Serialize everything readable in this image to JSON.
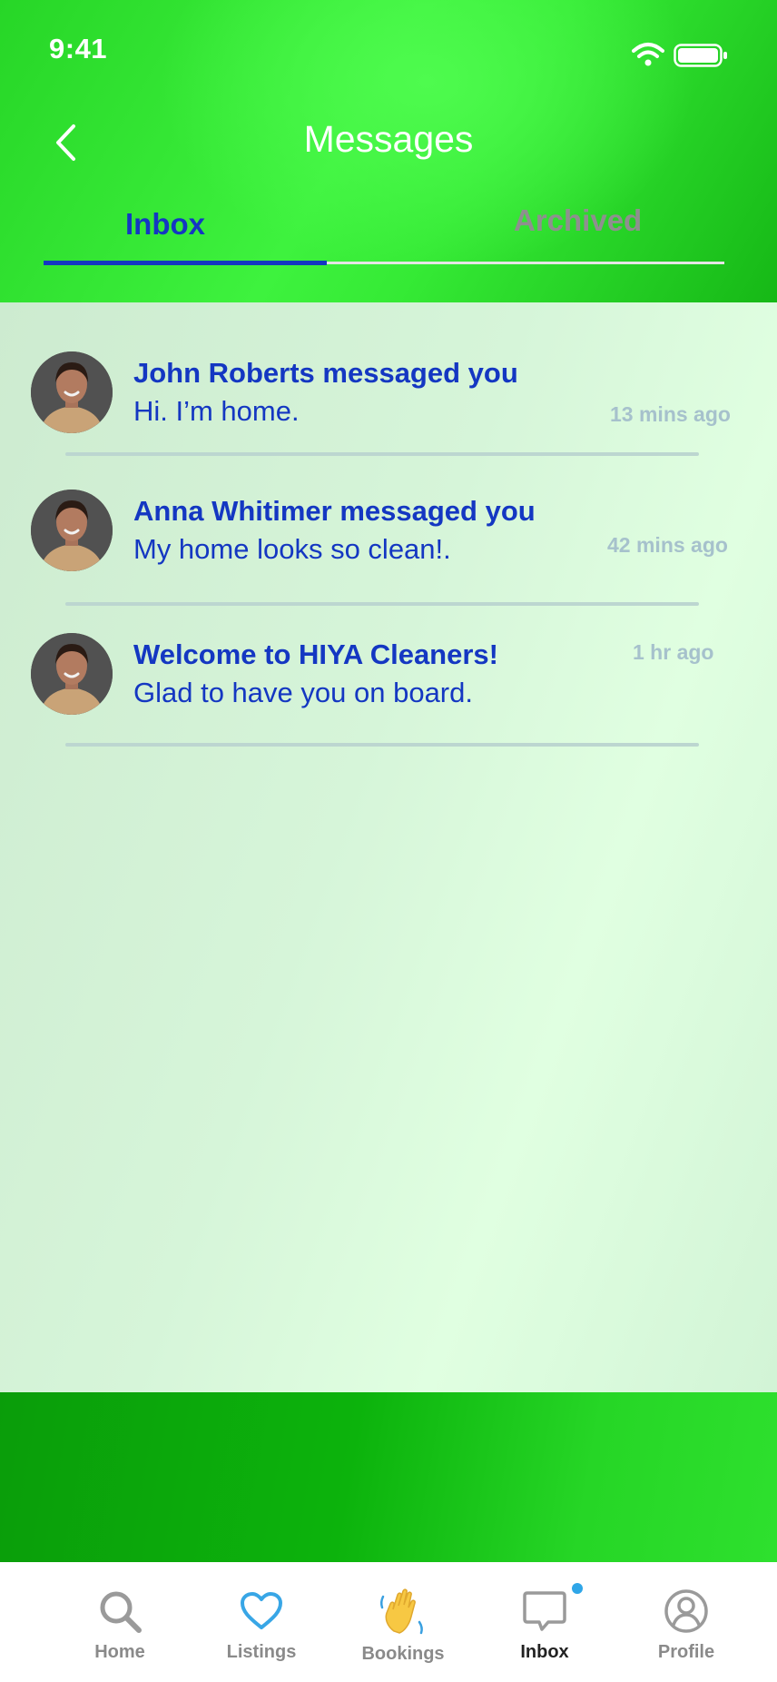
{
  "status_bar": {
    "time": "9:41"
  },
  "header": {
    "title": "Messages",
    "tabs": [
      {
        "label": "Inbox",
        "active": true
      },
      {
        "label": "Archived",
        "active": false
      }
    ]
  },
  "messages": [
    {
      "title": "John Roberts messaged you",
      "preview": "Hi. I’m home.",
      "time": "13 mins ago"
    },
    {
      "title": "Anna Whitimer messaged you",
      "preview": "My home looks so clean!.",
      "time": "42 mins ago"
    },
    {
      "title": "Welcome to HIYA Cleaners!",
      "preview": "Glad to have you on board.",
      "time": "1 hr ago"
    }
  ],
  "bottom_nav": {
    "items": [
      {
        "label": "Home",
        "icon": "search-icon",
        "active": false
      },
      {
        "label": "Listings",
        "icon": "heart-icon",
        "active": false
      },
      {
        "label": "Bookings",
        "icon": "waving-hand-icon",
        "active": false
      },
      {
        "label": "Inbox",
        "icon": "chat-bubble-icon",
        "active": true,
        "has_notification": true
      },
      {
        "label": "Profile",
        "icon": "user-icon",
        "active": false
      }
    ]
  },
  "colors": {
    "accent": "#1437c2",
    "header_green": "#3ef23e",
    "footer_green": "#0cb30c",
    "muted_time": "#a6c1cc",
    "notification": "#2fa6e8"
  }
}
